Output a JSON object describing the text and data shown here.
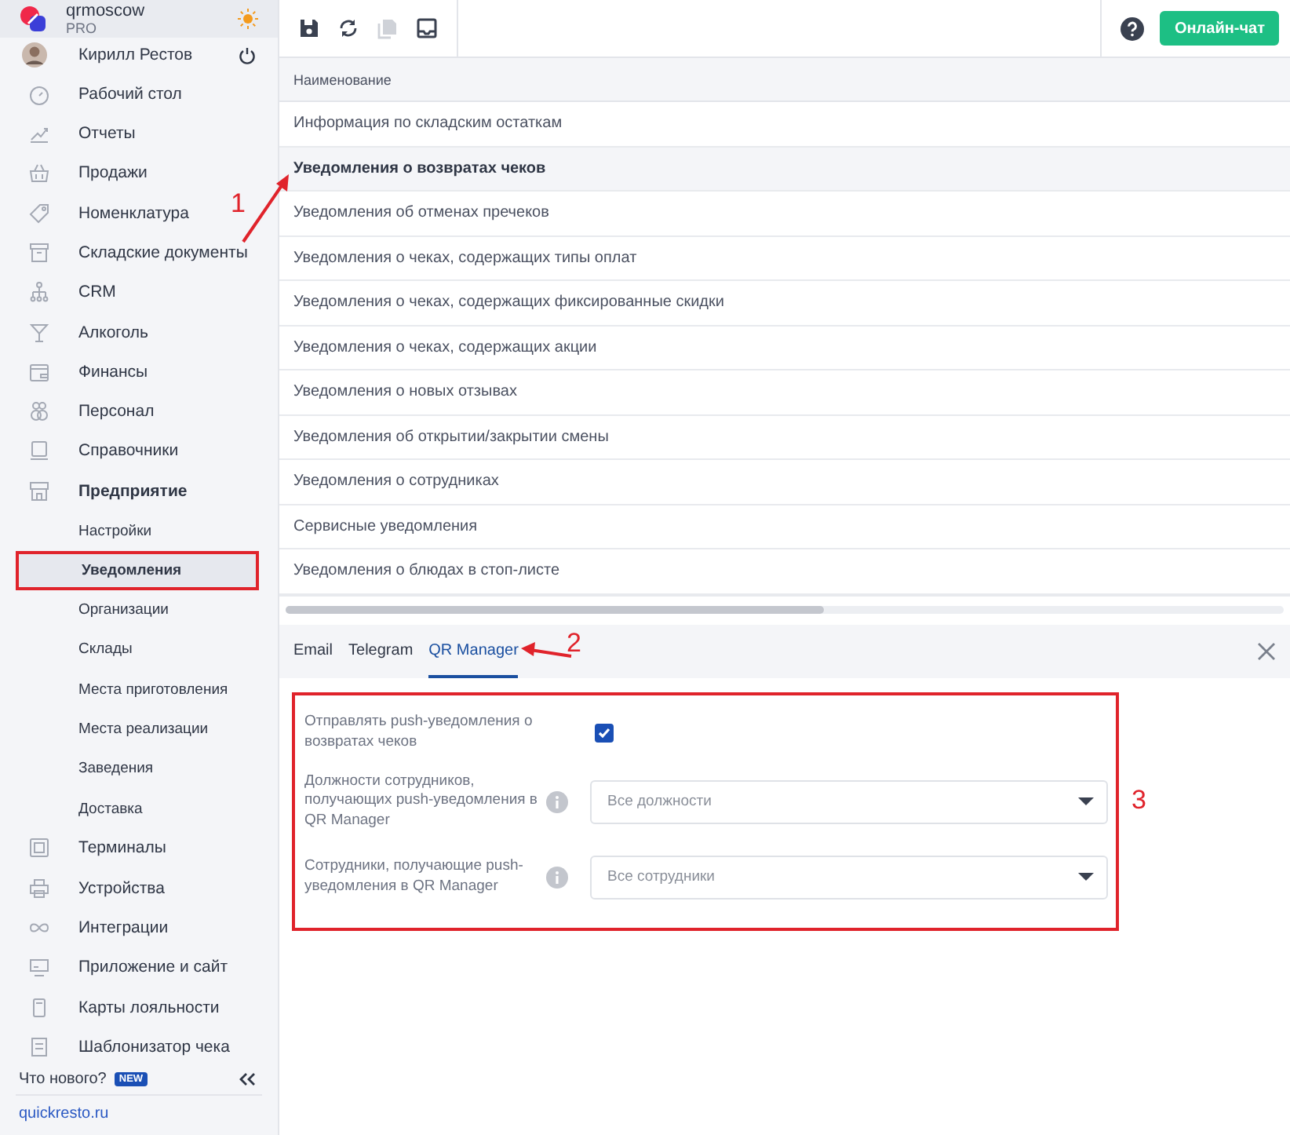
{
  "brand": {
    "name": "qrmoscow",
    "plan": "PRO"
  },
  "user": {
    "name": "Кирилл Рестов"
  },
  "sidebar": {
    "items": [
      {
        "label": "Рабочий стол",
        "selected": false
      },
      {
        "label": "Отчеты",
        "selected": false
      },
      {
        "label": "Продажи",
        "selected": false
      },
      {
        "label": "Номенклатура",
        "selected": false
      },
      {
        "label": "Складские документы",
        "selected": false
      },
      {
        "label": "CRM",
        "selected": false
      },
      {
        "label": "Алкоголь",
        "selected": false
      },
      {
        "label": "Финансы",
        "selected": false
      },
      {
        "label": "Персонал",
        "selected": false
      },
      {
        "label": "Справочники",
        "selected": false
      },
      {
        "label": "Предприятие",
        "selected": false,
        "expanded": true,
        "children": [
          {
            "label": "Настройки",
            "selected": false,
            "highlighted": false
          },
          {
            "label": "Уведомления",
            "selected": true,
            "highlighted": true
          },
          {
            "label": "Организации",
            "selected": false,
            "highlighted": false
          },
          {
            "label": "Склады",
            "selected": false,
            "highlighted": false
          },
          {
            "label": "Места приготовления",
            "selected": false,
            "highlighted": false
          },
          {
            "label": "Места реализации",
            "selected": false,
            "highlighted": false
          },
          {
            "label": "Заведения",
            "selected": false,
            "highlighted": false
          },
          {
            "label": "Доставка",
            "selected": false,
            "highlighted": false
          }
        ]
      },
      {
        "label": "Терминалы",
        "selected": false
      },
      {
        "label": "Устройства",
        "selected": false
      },
      {
        "label": "Интеграции",
        "selected": false
      },
      {
        "label": "Приложение и сайт",
        "selected": false
      },
      {
        "label": "Карты лояльности",
        "selected": false
      },
      {
        "label": "Шаблонизатор чека",
        "selected": false
      }
    ]
  },
  "whats_new": {
    "label": "Что нового?",
    "badge": "NEW"
  },
  "footer_link": "quickresto.ru",
  "toolbar": {
    "buttons": [
      {
        "kind": "save",
        "disabled": false
      },
      {
        "kind": "refresh",
        "disabled": false
      },
      {
        "kind": "copy",
        "disabled": true
      },
      {
        "kind": "inbox",
        "disabled": false
      }
    ],
    "chat_button": "Онлайн-чат"
  },
  "table": {
    "columns": [
      "Наименование"
    ],
    "rows": [
      {
        "name": "Информация по складским остаткам",
        "selected": false
      },
      {
        "name": "Уведомления о возвратах чеков",
        "selected": true
      },
      {
        "name": "Уведомления об отменах пречеков",
        "selected": false
      },
      {
        "name": "Уведомления о чеках, содержащих типы оплат",
        "selected": false
      },
      {
        "name": "Уведомления о чеках, содержащих фиксированные скидки",
        "selected": false
      },
      {
        "name": "Уведомления о чеках, содержащих акции",
        "selected": false
      },
      {
        "name": "Уведомления о новых отзывах",
        "selected": false
      },
      {
        "name": "Уведомления об открытии/закрытии смены",
        "selected": false
      },
      {
        "name": "Уведомления о сотрудниках",
        "selected": false
      },
      {
        "name": "Сервисные уведомления",
        "selected": false
      },
      {
        "name": "Уведомления о блюдах в стоп-листе",
        "selected": false
      }
    ]
  },
  "detail": {
    "tabs": [
      {
        "label": "Email",
        "selected": false
      },
      {
        "label": "Telegram",
        "selected": false
      },
      {
        "label": "QR Manager",
        "selected": true
      }
    ],
    "form": {
      "highlighted": true,
      "fields": [
        {
          "kind": "checkbox",
          "label": "Отправлять push-уведомления о возвратах чеков",
          "checked": true
        },
        {
          "kind": "select",
          "label": "Должности сотрудников, получающих push-уведомления в QR Manager",
          "placeholder": "Все должности"
        },
        {
          "kind": "select",
          "label": "Сотрудники, получающие push-уведомления в QR Manager",
          "placeholder": "Все сотрудники"
        }
      ]
    }
  },
  "annotations": [
    {
      "label": "1"
    },
    {
      "label": "2"
    },
    {
      "label": "3"
    }
  ]
}
